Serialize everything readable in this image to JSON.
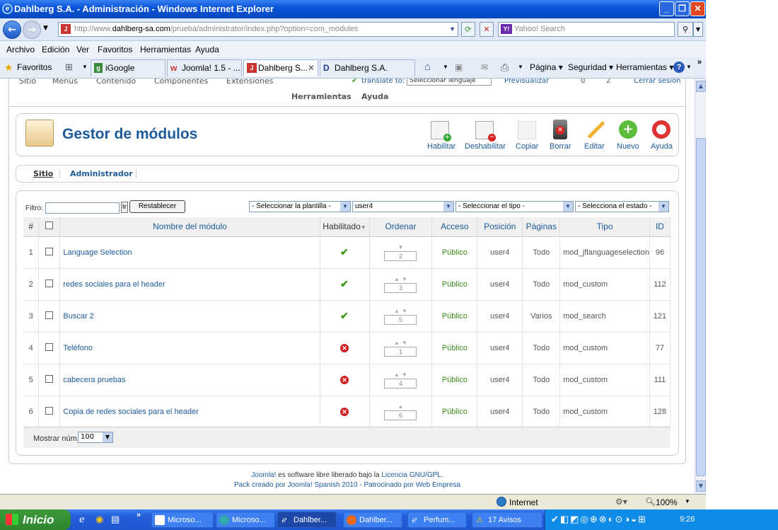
{
  "window": {
    "title": "Dahlberg S.A. - Administración - Windows Internet Explorer"
  },
  "address": {
    "prefix": "http://www.",
    "domain": "dahlberg-sa.com",
    "path": "/prueba/administrator/index.php?option=com_modules"
  },
  "search": {
    "placeholder": "Yahoo! Search"
  },
  "menu": [
    "Archivo",
    "Edición",
    "Ver",
    "Favoritos",
    "Herramientas",
    "Ayuda"
  ],
  "favorites": {
    "label": "Favoritos",
    "tabs": [
      "iGoogle",
      "Joomla! 1.5 - ...",
      "Dahlberg S...",
      "Dahlberg S.A."
    ]
  },
  "ie_toolbar": {
    "page": "Página",
    "security": "Seguridad",
    "tools": "Herramientas"
  },
  "joomla": {
    "top_partial": [
      "Sitio",
      "Menús",
      "Contenido",
      "Componentes",
      "Extensiones"
    ],
    "top_right": [
      "Herramientas",
      "Ayuda"
    ],
    "translate": "translate to:",
    "lang_select": "Seleccionar lenguaje",
    "preview": "Previsualizar",
    "counts": [
      "0",
      "2"
    ],
    "logout": "Cerrar sesión",
    "page_title": "Gestor de módulos",
    "toolbar": [
      "Habilitar",
      "Deshabilitar",
      "Copiar",
      "Borrar",
      "Editar",
      "Nuevo",
      "Ayuda"
    ],
    "subtabs": [
      "Sitio",
      "Administrador"
    ],
    "filter_label": "Filtro:",
    "go": "Ir",
    "reset": "Restablecer",
    "filters": [
      "- Seleccionar la plantilla -",
      "user4",
      "- Seleccionar el tipo -",
      "- Selecciona el estado -"
    ],
    "columns": [
      "#",
      "",
      "Nombre del módulo",
      "Habilitado",
      "Ordenar",
      "Acceso",
      "Posición",
      "Páginas",
      "Tipo",
      "ID"
    ],
    "rows": [
      {
        "n": "1",
        "name": "Language Selection",
        "enabled": true,
        "order": "2",
        "access": "Público",
        "position": "user4",
        "pages": "Todo",
        "type": "mod_jflanguageselection",
        "id": "96"
      },
      {
        "n": "2",
        "name": "redes sociales para el header",
        "enabled": true,
        "order": "3",
        "access": "Público",
        "position": "user4",
        "pages": "Todo",
        "type": "mod_custom",
        "id": "112"
      },
      {
        "n": "3",
        "name": "Buscar 2",
        "enabled": true,
        "order": "5",
        "access": "Público",
        "position": "user4",
        "pages": "Varios",
        "type": "mod_search",
        "id": "121"
      },
      {
        "n": "4",
        "name": "Teléfono",
        "enabled": false,
        "order": "1",
        "access": "Público",
        "position": "user4",
        "pages": "Todo",
        "type": "mod_custom",
        "id": "77"
      },
      {
        "n": "5",
        "name": "cabecera pruebas",
        "enabled": false,
        "order": "4",
        "access": "Público",
        "position": "user4",
        "pages": "Todo",
        "type": "mod_custom",
        "id": "111"
      },
      {
        "n": "6",
        "name": "Copia de redes sociales para el header",
        "enabled": false,
        "order": "6",
        "access": "Público",
        "position": "user4",
        "pages": "Todo",
        "type": "mod_custom",
        "id": "128"
      }
    ],
    "show_label": "Mostrar núm.",
    "show_value": "100",
    "footer1_a": "Joomla!",
    "footer1_b": " es software libre liberado bajo la ",
    "footer1_c": "Licencia GNU/GPL",
    "footer2_a": "Pack creado por ",
    "footer2_b": "Joomla! Spanish 2010",
    "footer2_c": " - Patrocinado por ",
    "footer2_d": "Web Empresa"
  },
  "status": {
    "zone": "Internet",
    "zoom": "100%"
  },
  "taskbar": {
    "start": "Inicio",
    "tasks": [
      "Microso...",
      "Microso...",
      "Dahlber...",
      "Dahlber...",
      "Perfum...",
      "17 Avisos"
    ],
    "clock": "9:26"
  }
}
